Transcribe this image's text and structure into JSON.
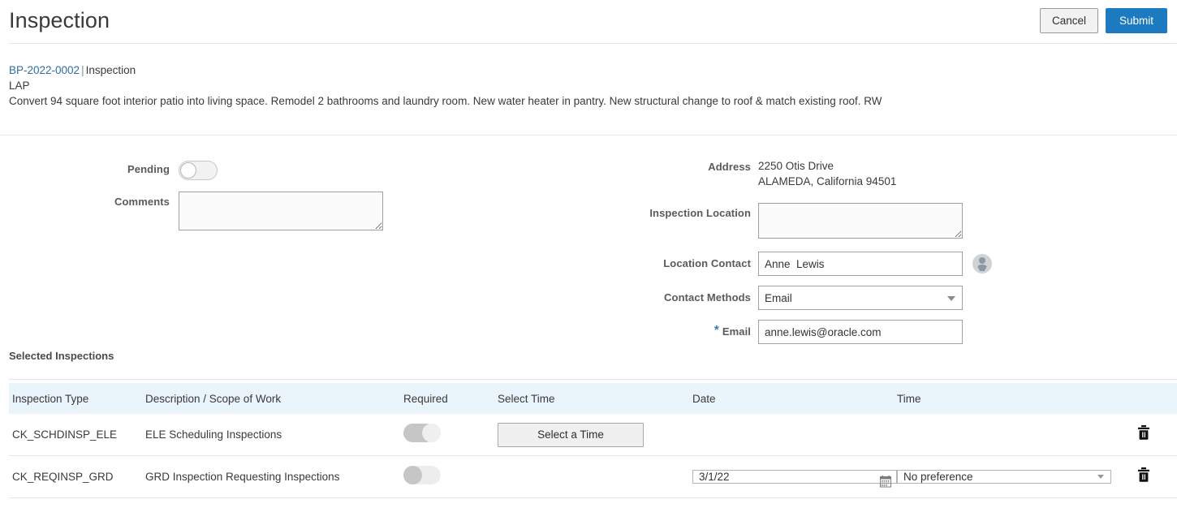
{
  "header": {
    "title": "Inspection",
    "cancel_label": "Cancel",
    "submit_label": "Submit",
    "accent_color": "#1c7ac0"
  },
  "record": {
    "permit_number": "BP-2022-0002",
    "separator": "|",
    "record_type": "Inspection",
    "code": "LAP",
    "description": "Convert 94 square foot interior patio into living space. Remodel 2 bathrooms and laundry room. New water heater in pantry. New structural change to roof & match existing roof. RW"
  },
  "form": {
    "pending": {
      "label": "Pending",
      "state": "off"
    },
    "comments": {
      "label": "Comments",
      "value": "",
      "placeholder": ""
    },
    "address": {
      "label": "Address",
      "line1": "2250 Otis Drive",
      "line2": "ALAMEDA, California 94501"
    },
    "inspection_location": {
      "label": "Inspection Location",
      "value": "",
      "placeholder": ""
    },
    "location_contact": {
      "label": "Location Contact",
      "value": "Anne  Lewis",
      "placeholder": "",
      "avatar_icon": "person-avatar-icon"
    },
    "contact_methods": {
      "label": "Contact Methods",
      "value": "Email",
      "options": [
        "Email"
      ]
    },
    "email": {
      "label": "Email",
      "required_marker": "*",
      "value": "anne.lewis@oracle.com",
      "placeholder": ""
    }
  },
  "table": {
    "section_title": "Selected Inspections",
    "header_bg": "#eaf4fb",
    "columns": [
      "Inspection Type",
      "Description / Scope of Work",
      "Required",
      "Select Time",
      "Date",
      "Time"
    ],
    "rows": [
      {
        "inspection_type": "CK_SCHDINSP_ELE",
        "description": "ELE Scheduling Inspections",
        "required_state": "on-disabled",
        "select_time_label": "Select a Time",
        "has_select_time_button": true,
        "date": "",
        "has_date_field": false,
        "time": "",
        "has_time_field": false,
        "delete_icon": "trash-icon"
      },
      {
        "inspection_type": "CK_REQINSP_GRD",
        "description": "GRD Inspection Requesting Inspections",
        "required_state": "off-disabled",
        "select_time_label": "",
        "has_select_time_button": false,
        "date": "3/1/22",
        "has_date_field": true,
        "time": "No preference",
        "time_options": [
          "No preference"
        ],
        "has_time_field": true,
        "delete_icon": "trash-icon"
      }
    ]
  }
}
